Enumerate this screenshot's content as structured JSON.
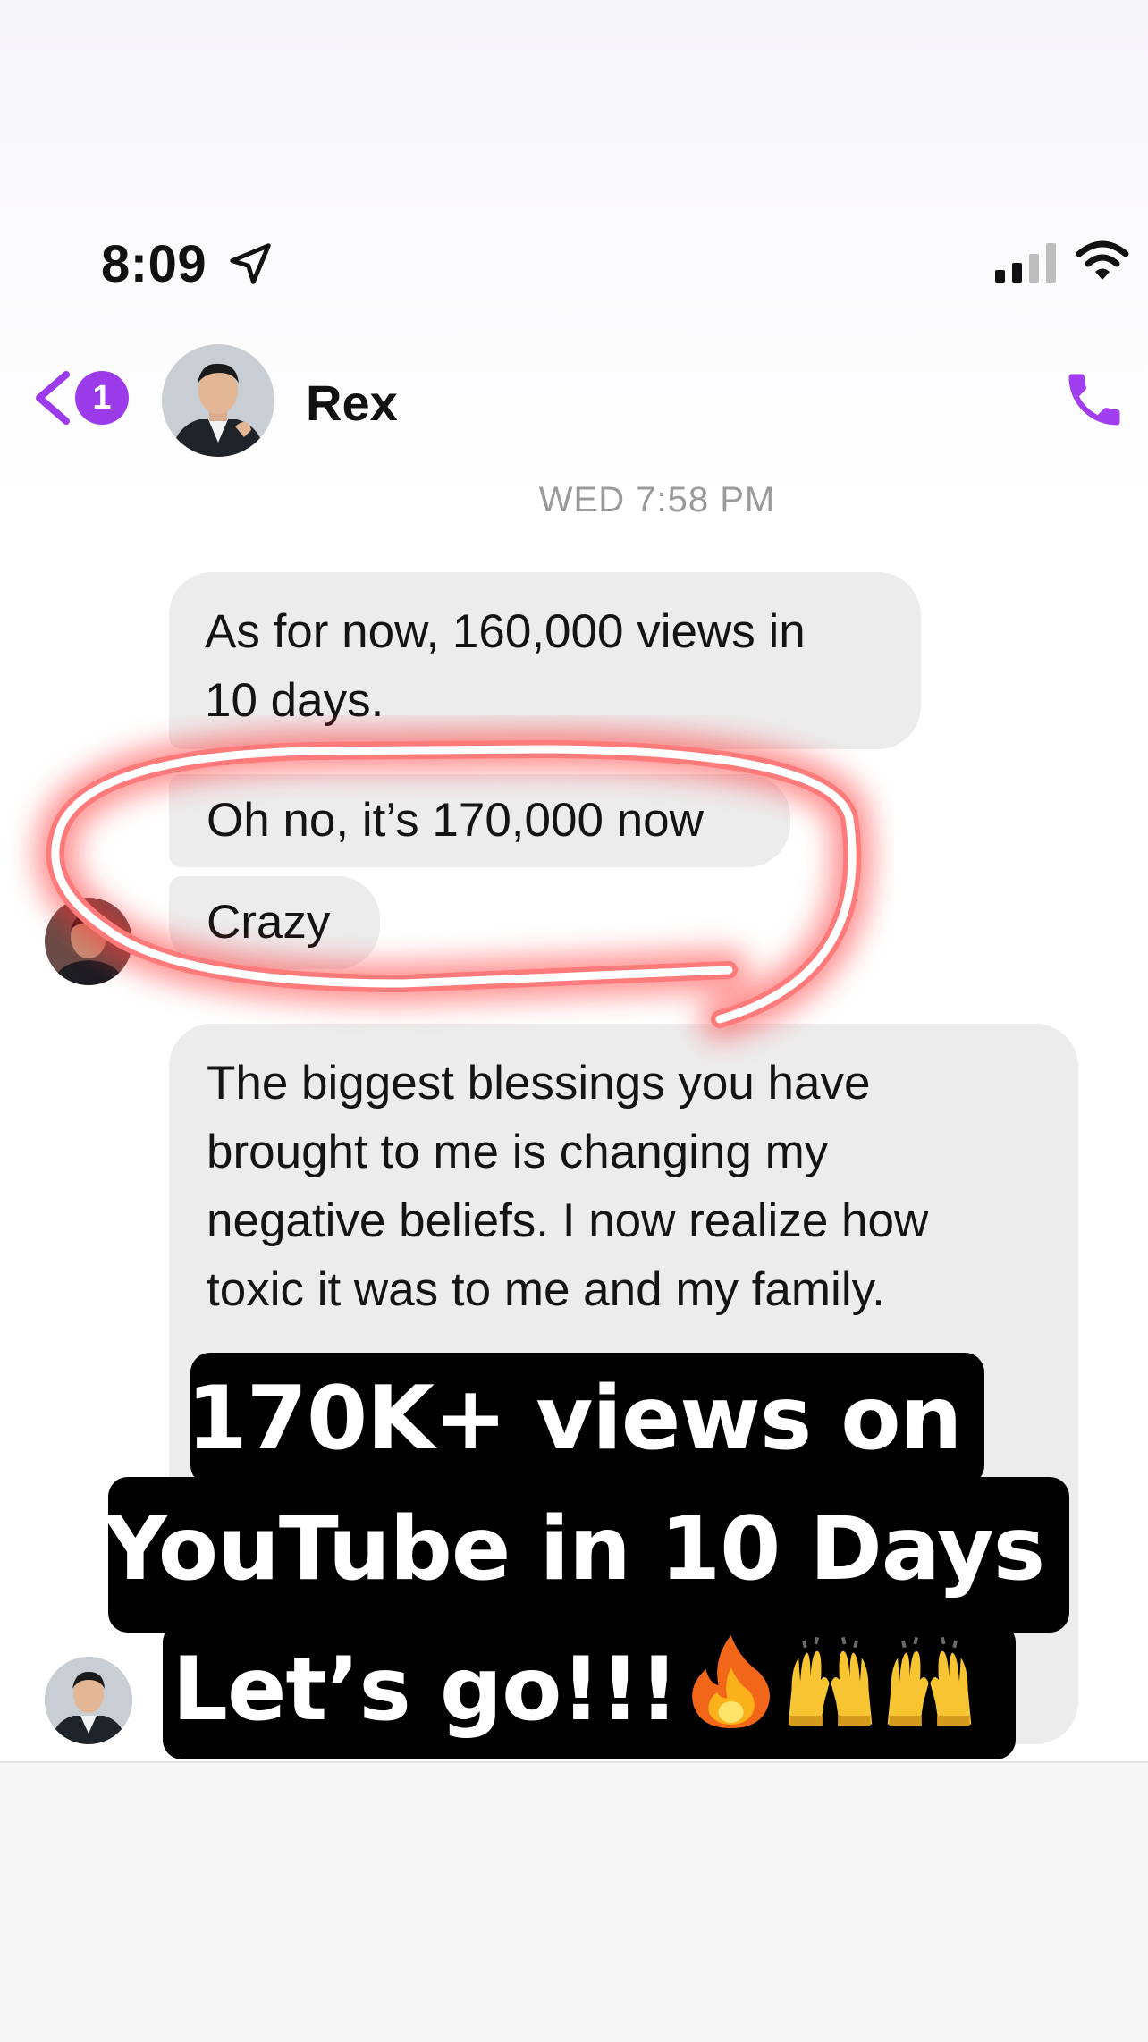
{
  "status_bar": {
    "time": "8:09",
    "icons": [
      "location-arrow-icon",
      "cellular-signal-icon",
      "wifi-icon"
    ]
  },
  "header": {
    "back_icon": "chevron-left-icon",
    "unread_count": "1",
    "contact_name": "Rex",
    "call_icon": "phone-icon"
  },
  "conversation": {
    "timestamp": "WED 7:58 PM",
    "messages": [
      {
        "text": "As for now, 160,000 views in\n10 days."
      },
      {
        "text": "Oh no, it’s 170,000 now"
      },
      {
        "text": "Crazy"
      },
      {
        "text": "The biggest blessings you have\nbrought to me is changing my\nnegative beliefs. I now realize how\ntoxic it was to me and my family."
      }
    ]
  },
  "caption": {
    "line1": "170K+ views on",
    "line2": "YouTube in 10 Days",
    "line3": "Let’s go!!!",
    "emojis": [
      "fire-emoji",
      "raising-hands-emoji",
      "raising-hands-emoji"
    ]
  },
  "colors": {
    "accent": "#9b3bea",
    "bubble": "#ececed",
    "highlight": "#ff4d4d"
  }
}
